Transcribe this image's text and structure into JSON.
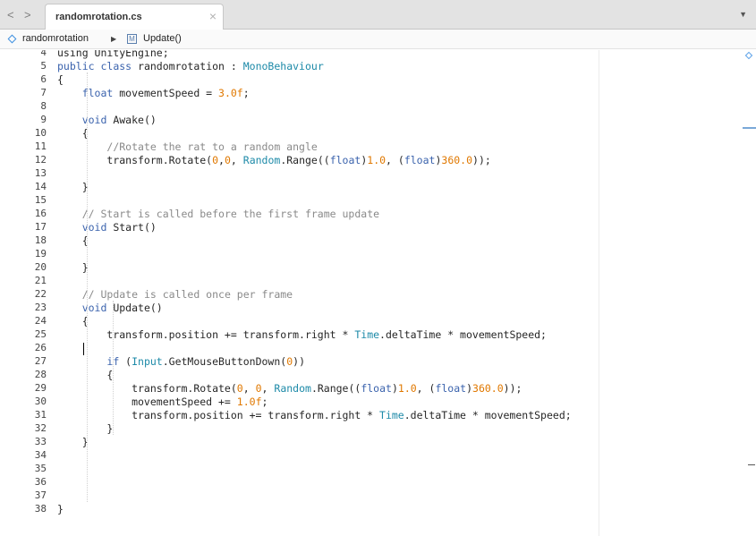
{
  "nav": {
    "back_glyph": "<",
    "forward_glyph": ">"
  },
  "tab": {
    "title": "randomrotation.cs",
    "close_glyph": "×"
  },
  "overflow_glyph": "▼",
  "breadcrumb": {
    "class_name": "randomrotation",
    "separator": "▶",
    "method_badge": "M",
    "method_name": "Update()"
  },
  "colors": {
    "keyword": "#3b63ad",
    "number": "#e07800",
    "comment": "#8a8a8a",
    "type": "#1d8aa8",
    "text": "#262626"
  },
  "editor": {
    "cursor_line": 26,
    "lines": [
      {
        "n": 4,
        "t": [
          [
            "p",
            "using UnityEngine;"
          ]
        ]
      },
      {
        "n": 5,
        "t": [
          [
            "k",
            "public"
          ],
          [
            "p",
            " "
          ],
          [
            "k",
            "class"
          ],
          [
            "p",
            " randomrotation : "
          ],
          [
            "ty",
            "MonoBehaviour"
          ]
        ]
      },
      {
        "n": 6,
        "t": [
          [
            "p",
            "{"
          ]
        ]
      },
      {
        "n": 7,
        "t": [
          [
            "p",
            "    "
          ],
          [
            "k",
            "float"
          ],
          [
            "p",
            " movementSpeed = "
          ],
          [
            "n",
            "3.0f"
          ],
          [
            "p",
            ";"
          ]
        ]
      },
      {
        "n": 8,
        "t": []
      },
      {
        "n": 9,
        "t": [
          [
            "p",
            "    "
          ],
          [
            "k",
            "void"
          ],
          [
            "p",
            " Awake()"
          ]
        ]
      },
      {
        "n": 10,
        "t": [
          [
            "p",
            "    {"
          ]
        ]
      },
      {
        "n": 11,
        "t": [
          [
            "p",
            "        "
          ],
          [
            "c",
            "//Rotate the rat to a random angle"
          ]
        ]
      },
      {
        "n": 12,
        "t": [
          [
            "p",
            "        transform.Rotate("
          ],
          [
            "n",
            "0"
          ],
          [
            "p",
            ","
          ],
          [
            "n",
            "0"
          ],
          [
            "p",
            ", "
          ],
          [
            "ty",
            "Random"
          ],
          [
            "p",
            ".Range(("
          ],
          [
            "k",
            "float"
          ],
          [
            "p",
            ")"
          ],
          [
            "n",
            "1.0"
          ],
          [
            "p",
            ", ("
          ],
          [
            "k",
            "float"
          ],
          [
            "p",
            ")"
          ],
          [
            "n",
            "360.0"
          ],
          [
            "p",
            "));"
          ]
        ]
      },
      {
        "n": 13,
        "t": []
      },
      {
        "n": 14,
        "t": [
          [
            "p",
            "    }"
          ]
        ]
      },
      {
        "n": 15,
        "t": []
      },
      {
        "n": 16,
        "t": [
          [
            "p",
            "    "
          ],
          [
            "c",
            "// Start is called before the first frame update"
          ]
        ]
      },
      {
        "n": 17,
        "t": [
          [
            "p",
            "    "
          ],
          [
            "k",
            "void"
          ],
          [
            "p",
            " Start()"
          ]
        ]
      },
      {
        "n": 18,
        "t": [
          [
            "p",
            "    {"
          ]
        ]
      },
      {
        "n": 19,
        "t": []
      },
      {
        "n": 20,
        "t": [
          [
            "p",
            "    }"
          ]
        ]
      },
      {
        "n": 21,
        "t": []
      },
      {
        "n": 22,
        "t": [
          [
            "p",
            "    "
          ],
          [
            "c",
            "// Update is called once per frame"
          ]
        ]
      },
      {
        "n": 23,
        "t": [
          [
            "p",
            "    "
          ],
          [
            "k",
            "void"
          ],
          [
            "p",
            " Update()"
          ]
        ]
      },
      {
        "n": 24,
        "t": [
          [
            "p",
            "    {"
          ]
        ]
      },
      {
        "n": 25,
        "t": [
          [
            "p",
            "        transform.position += transform.right * "
          ],
          [
            "ty",
            "Time"
          ],
          [
            "p",
            ".deltaTime * movementSpeed;"
          ]
        ]
      },
      {
        "n": 26,
        "t": []
      },
      {
        "n": 27,
        "t": [
          [
            "p",
            "        "
          ],
          [
            "k",
            "if"
          ],
          [
            "p",
            " ("
          ],
          [
            "ty",
            "Input"
          ],
          [
            "p",
            ".GetMouseButtonDown("
          ],
          [
            "n",
            "0"
          ],
          [
            "p",
            "))"
          ]
        ]
      },
      {
        "n": 28,
        "t": [
          [
            "p",
            "        {"
          ]
        ]
      },
      {
        "n": 29,
        "t": [
          [
            "p",
            "            transform.Rotate("
          ],
          [
            "n",
            "0"
          ],
          [
            "p",
            ", "
          ],
          [
            "n",
            "0"
          ],
          [
            "p",
            ", "
          ],
          [
            "ty",
            "Random"
          ],
          [
            "p",
            ".Range(("
          ],
          [
            "k",
            "float"
          ],
          [
            "p",
            ")"
          ],
          [
            "n",
            "1.0"
          ],
          [
            "p",
            ", ("
          ],
          [
            "k",
            "float"
          ],
          [
            "p",
            ")"
          ],
          [
            "n",
            "360.0"
          ],
          [
            "p",
            "));"
          ]
        ]
      },
      {
        "n": 30,
        "t": [
          [
            "p",
            "            movementSpeed += "
          ],
          [
            "n",
            "1.0f"
          ],
          [
            "p",
            ";"
          ]
        ]
      },
      {
        "n": 31,
        "t": [
          [
            "p",
            "            transform.position += transform.right * "
          ],
          [
            "ty",
            "Time"
          ],
          [
            "p",
            ".deltaTime * movementSpeed;"
          ]
        ]
      },
      {
        "n": 32,
        "t": [
          [
            "p",
            "        }"
          ]
        ]
      },
      {
        "n": 33,
        "t": [
          [
            "p",
            "    }"
          ]
        ]
      },
      {
        "n": 34,
        "t": []
      },
      {
        "n": 35,
        "t": []
      },
      {
        "n": 36,
        "t": []
      },
      {
        "n": 37,
        "t": []
      },
      {
        "n": 38,
        "t": [
          [
            "p",
            "}"
          ]
        ]
      }
    ]
  }
}
